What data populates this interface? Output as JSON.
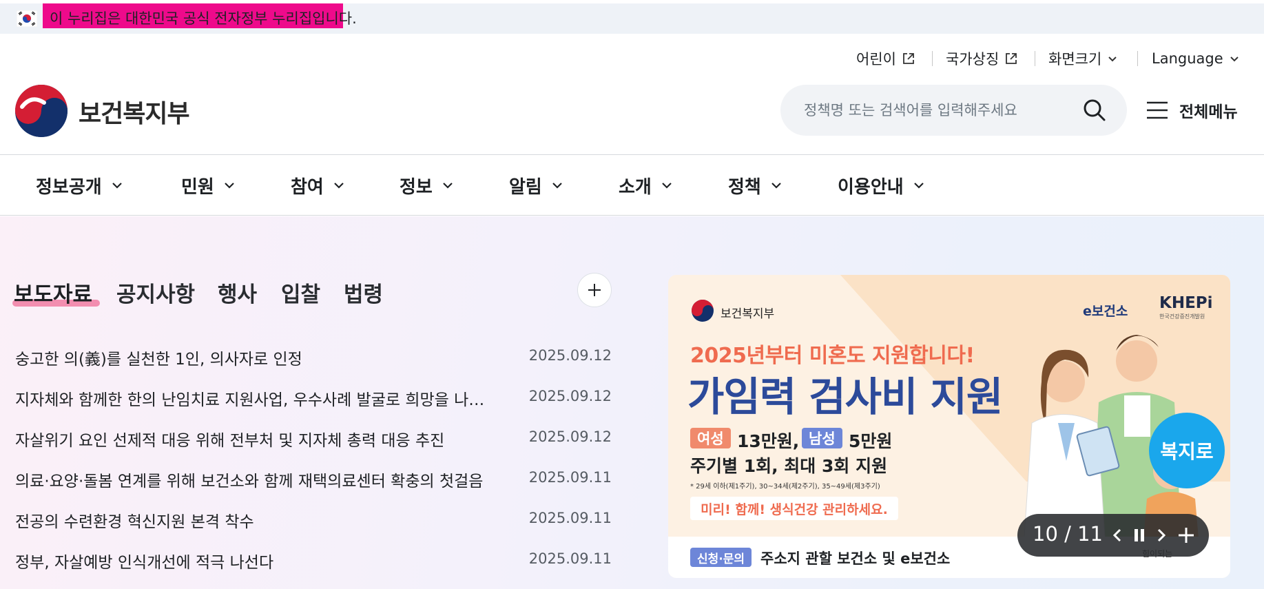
{
  "gov_banner": {
    "text": "이 누리집은 대한민국 공식 전자정부 누리집입니다."
  },
  "utility": {
    "children": "어린이",
    "national_symbol": "국가상징",
    "screen_size": "화면크기",
    "language": "Language"
  },
  "header": {
    "logo_text": "보건복지부",
    "search_placeholder": "정책명 또는 검색어를 입력해주세요",
    "all_menu": "전체메뉴"
  },
  "gnb": [
    "정보공개",
    "민원",
    "참여",
    "정보",
    "알림",
    "소개",
    "정책",
    "이용안내"
  ],
  "board": {
    "tabs": [
      "보도자료",
      "공지사항",
      "행사",
      "입찰",
      "법령"
    ],
    "active_tab": "보도자료",
    "items": [
      {
        "title": "숭고한 의(義)를 실천한 1인, 의사자로 인정",
        "date": "2025.09.12"
      },
      {
        "title": "지자체와 함께한 한의 난임치료 지원사업, 우수사례 발굴로 희망을 나누다",
        "date": "2025.09.12"
      },
      {
        "title": "자살위기 요인 선제적 대응 위해 전부처 및 지자체 총력 대응 추진",
        "date": "2025.09.12"
      },
      {
        "title": "의료·요양·돌봄 연계를 위해 보건소와 함께 재택의료센터 확충의 첫걸음",
        "date": "2025.09.11"
      },
      {
        "title": "전공의 수련환경 혁신지원 본격 착수",
        "date": "2025.09.11"
      },
      {
        "title": "정부, 자살예방 인식개선에 적극 나선다",
        "date": "2025.09.11"
      }
    ]
  },
  "promo": {
    "org": "보건복지부",
    "partner1": "e보건소",
    "partner2": "KHEPi",
    "partner2_sub": "한국건강증진개발원",
    "headline_small": "2025년부터 미혼도 지원합니다!",
    "headline_big": "가임력 검사비 지원",
    "female_chip": "여성",
    "female_amount": "13만원,",
    "male_chip": "남성",
    "male_amount": "5만원",
    "cycle": "주기별 1회, 최대 3회 지원",
    "note": "* 29세 이하(제1주기), 30~34세(제2주기), 35~49세(제3주기)",
    "slogan": "미리! 함께! 생식건강 관리하세요.",
    "contact_chip": "신청·문의",
    "contact_text": "주소지 관할 보건소 및 e보건소",
    "badge": "복지로",
    "hotline_text": "힘이되는",
    "colors": {
      "accent_orange": "#ef6b4f",
      "accent_blue": "#2c4a9a",
      "badge_blue": "#1aa7ec"
    }
  },
  "slider": {
    "counter": "10 / 11"
  },
  "colors": {
    "gov_highlight": "#ee0a8b",
    "tab_underline": "#f07ca3"
  }
}
